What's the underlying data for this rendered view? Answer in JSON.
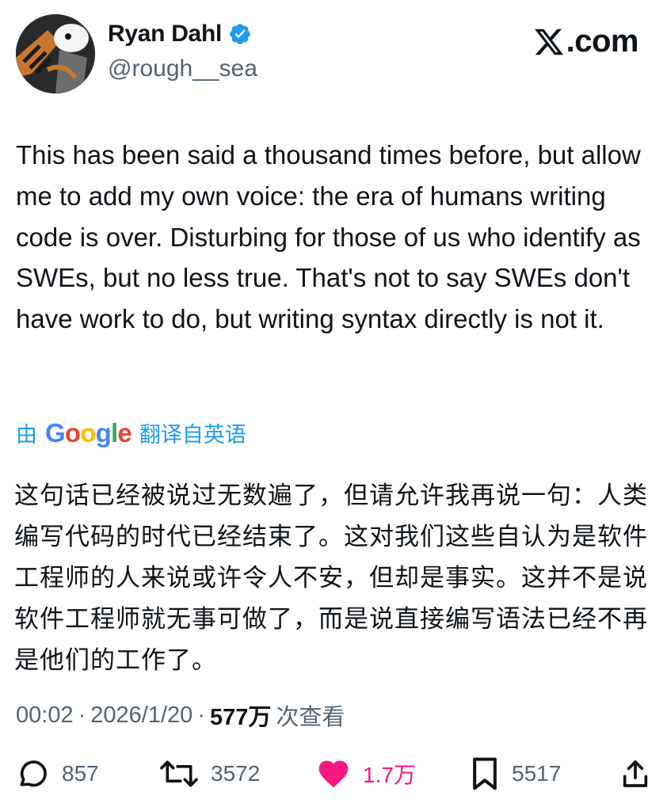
{
  "author": {
    "display_name": "Ryan Dahl",
    "handle": "@rough__sea",
    "verified": true,
    "avatar_icon": "cartoon-avatar"
  },
  "brand": {
    "label": ".com",
    "icon": "x-logo-icon"
  },
  "tweet": {
    "text": "This has been said a thousand times before, but allow me to add my own voice: the era of humans writing code is over. Disturbing for those of us who identify as SWEs, but no less true. That's not to say SWEs don't have work to do, but writing syntax directly is not it."
  },
  "translation": {
    "prefix": "由",
    "provider": "Google",
    "suffix": "翻译自英语",
    "text": "这句话已经被说过无数遍了，但请允许我再说一句：人类编写代码的时代已经结束了。这对我们这些自认为是软件工程师的人来说或许令人不安，但却是事实。这并不是说软件工程师就无事可做了，而是说直接编写语法已经不再是他们的工作了。"
  },
  "meta": {
    "time": "00:02",
    "date": "2026/1/20",
    "views_count": "577万",
    "views_label": "次查看",
    "separator": "·"
  },
  "actions": {
    "replies": "857",
    "reposts": "3572",
    "likes": "1.7万",
    "bookmarks": "5517"
  },
  "colors": {
    "text": "#0f1419",
    "secondary": "#536471",
    "link_blue": "#1d9bf0",
    "like_pink": "#f91880",
    "verified_blue": "#1d9bf0"
  }
}
